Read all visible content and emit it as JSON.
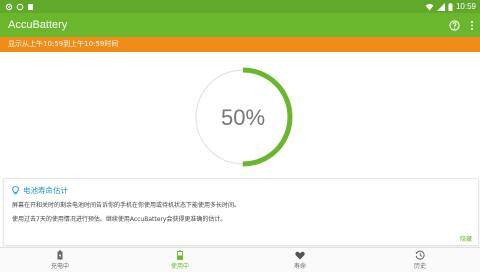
{
  "status_bar": {
    "time": "10:59",
    "icons": [
      "settings-icon",
      "circle-icon",
      "sd-card-icon",
      "wifi-icon",
      "signal-icon",
      "battery-icon"
    ]
  },
  "app_bar": {
    "title": "AccuBattery",
    "actions": [
      "help-icon",
      "more-vert-icon"
    ]
  },
  "banner": {
    "text": "显示从上午10:59到上午10:59时间"
  },
  "gauge": {
    "value_text": "50%",
    "level": 0.5,
    "color": "#6ab72e"
  },
  "card": {
    "title": "电池寿命估计",
    "line1": "屏幕在开和关时的剩余电池时间告诉你的手机在你使用或待机状态下能使用多长时间。",
    "line2": "使用过去7天的使用情况进行预估。继续使用AccuBattery会获得更准确的估计。",
    "hide_label": "隐藏"
  },
  "bottom_nav": {
    "items": [
      {
        "label": "充电中",
        "icon": "battery-charging-icon",
        "active": false
      },
      {
        "label": "使用中",
        "icon": "battery-discharging-icon",
        "active": true
      },
      {
        "label": "寿命",
        "icon": "heart-icon",
        "active": false
      },
      {
        "label": "历史",
        "icon": "history-icon",
        "active": false
      }
    ]
  }
}
